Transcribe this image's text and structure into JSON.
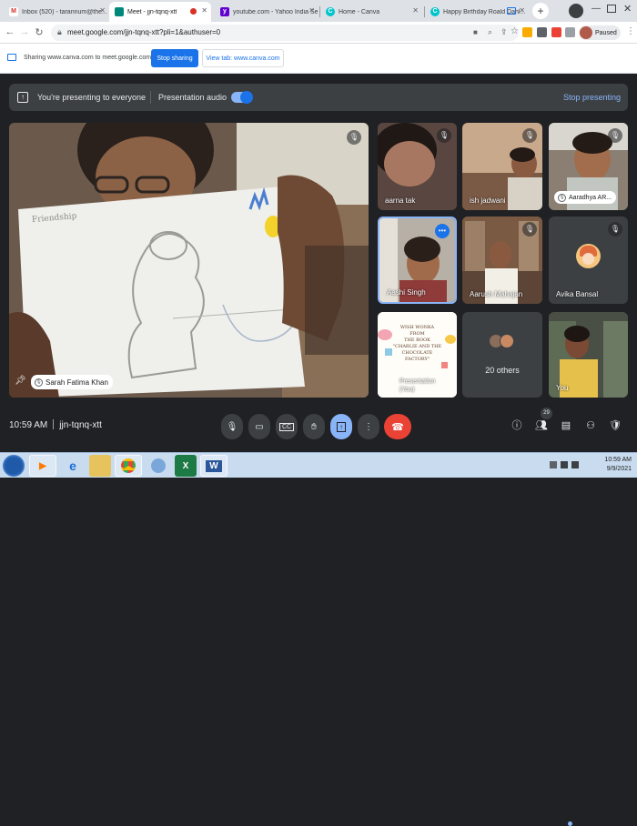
{
  "browser": {
    "tabs": [
      {
        "label": "Inbox (520) - tarannum@the...",
        "favicon": "gmail-icon",
        "color": "#d93025",
        "glyph": "M",
        "active": false
      },
      {
        "label": "Meet - jjn-tqnq-xtt",
        "favicon": "meet-icon",
        "color": "#00897b",
        "glyph": "",
        "active": true
      },
      {
        "label": "youtube.com - Yahoo India Se...",
        "favicon": "yahoo-icon",
        "color": "#6001d2",
        "glyph": "y",
        "active": false
      },
      {
        "label": "Home - Canva",
        "favicon": "canva-icon",
        "color": "#00c4cc",
        "glyph": "C",
        "active": false
      },
      {
        "label": "Happy Birthday Roald Dahl...",
        "favicon": "canva-icon",
        "color": "#00c4cc",
        "glyph": "C",
        "active": false
      }
    ],
    "url": "meet.google.com/jjn-tqnq-xtt?pli=1&authuser=0",
    "profile_status": "Paused"
  },
  "share_bar": {
    "message": "Sharing www.canva.com to meet.google.com",
    "stop_label": "Stop sharing",
    "view_label": "View tab: www.canva.com"
  },
  "presenting_bar": {
    "text": "You're presenting to everyone",
    "audio_label": "Presentation audio",
    "audio_on": true,
    "stop_label": "Stop presenting"
  },
  "main_tile": {
    "name": "Sarah Fatima Khan",
    "drawing_caption": "Friendship"
  },
  "participants": [
    {
      "name": "aarna tak",
      "muted": true,
      "style": "label"
    },
    {
      "name": "ish jadwani",
      "muted": true,
      "style": "label"
    },
    {
      "name": "Aaradhya AR...",
      "muted": true,
      "style": "chip"
    },
    {
      "name": "Aashi Singh",
      "muted": false,
      "style": "label",
      "highlight": true
    },
    {
      "name": "Aarush Mahajan",
      "muted": true,
      "style": "label"
    },
    {
      "name": "Avika Bansal",
      "muted": true,
      "style": "label"
    },
    {
      "name": "Presentation (You)",
      "muted": false,
      "style": "label"
    },
    {
      "name": "20 others",
      "muted": false,
      "style": "label"
    },
    {
      "name": "You",
      "muted": false,
      "style": "label"
    }
  ],
  "presentation_thumb": {
    "line1": "WISH WONKA",
    "line2": "FROM",
    "line3": "THE BOOK",
    "line4": "\"CHARLIE AND THE",
    "line5": "CHOCOLATE",
    "line6": "FACTORY\""
  },
  "controls": {
    "time": "10:59 AM",
    "meeting_code": "jjn-tqnq-xtt",
    "participant_count": "29"
  },
  "taskbar": {
    "time": "10:59 AM",
    "date": "9/9/2021"
  },
  "colors": {
    "meet_bg": "#202124",
    "accent_blue": "#1a73e8",
    "end_call_red": "#ea4335",
    "highlight_blue": "#8ab4f8"
  }
}
